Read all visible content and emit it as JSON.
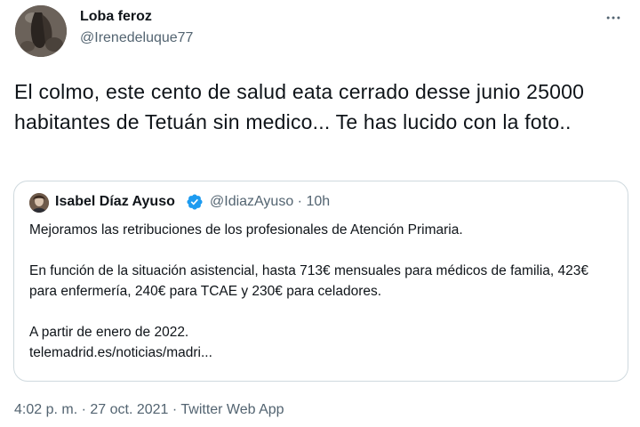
{
  "author": {
    "display_name": "Loba feroz",
    "handle": "@Irenedeluque77"
  },
  "tweet": {
    "text": "El colmo, este cento de salud eata cerrado desse junio 25000 habitantes de Tetuán sin medico... Te has lucido con la foto.."
  },
  "quoted_tweet": {
    "display_name": "Isabel Díaz Ayuso",
    "meta": "@IdiazAyuso · 10h",
    "paragraph_1": "Mejoramos las retribuciones de los profesionales de Atención Primaria.",
    "paragraph_2": "En función de la situación asistencial, hasta 713€ mensuales para médicos de familia, 423€ para enfermería, 240€ para TCAE y 230€ para celadores.",
    "paragraph_3": "A partir de enero de 2022.",
    "link": "telemadrid.es/noticias/madri..."
  },
  "footer": {
    "timestamp": "4:02 p. m. · 27 oct. 2021 · Twitter Web App"
  },
  "icons": {
    "more": "more-horizontal-icon",
    "verified": "verified-badge-icon"
  },
  "colors": {
    "text_primary": "#0f1419",
    "text_secondary": "#536471",
    "border": "#cfd9de",
    "verified_blue": "#1d9bf0"
  }
}
